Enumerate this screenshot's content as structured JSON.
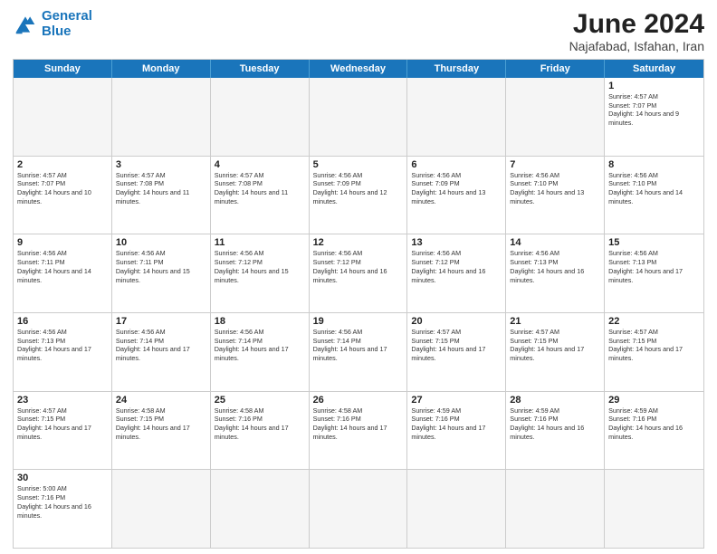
{
  "header": {
    "logo_general": "General",
    "logo_blue": "Blue",
    "title": "June 2024",
    "location": "Najafabad, Isfahan, Iran"
  },
  "weekdays": [
    "Sunday",
    "Monday",
    "Tuesday",
    "Wednesday",
    "Thursday",
    "Friday",
    "Saturday"
  ],
  "rows": [
    [
      {
        "day": "",
        "info": ""
      },
      {
        "day": "",
        "info": ""
      },
      {
        "day": "",
        "info": ""
      },
      {
        "day": "",
        "info": ""
      },
      {
        "day": "",
        "info": ""
      },
      {
        "day": "",
        "info": ""
      },
      {
        "day": "1",
        "info": "Sunrise: 4:57 AM\nSunset: 7:07 PM\nDaylight: 14 hours and 9 minutes."
      }
    ],
    [
      {
        "day": "2",
        "info": "Sunrise: 4:57 AM\nSunset: 7:07 PM\nDaylight: 14 hours and 10 minutes."
      },
      {
        "day": "3",
        "info": "Sunrise: 4:57 AM\nSunset: 7:08 PM\nDaylight: 14 hours and 11 minutes."
      },
      {
        "day": "4",
        "info": "Sunrise: 4:57 AM\nSunset: 7:08 PM\nDaylight: 14 hours and 11 minutes."
      },
      {
        "day": "5",
        "info": "Sunrise: 4:56 AM\nSunset: 7:09 PM\nDaylight: 14 hours and 12 minutes."
      },
      {
        "day": "6",
        "info": "Sunrise: 4:56 AM\nSunset: 7:09 PM\nDaylight: 14 hours and 13 minutes."
      },
      {
        "day": "7",
        "info": "Sunrise: 4:56 AM\nSunset: 7:10 PM\nDaylight: 14 hours and 13 minutes."
      },
      {
        "day": "8",
        "info": "Sunrise: 4:56 AM\nSunset: 7:10 PM\nDaylight: 14 hours and 14 minutes."
      }
    ],
    [
      {
        "day": "9",
        "info": "Sunrise: 4:56 AM\nSunset: 7:11 PM\nDaylight: 14 hours and 14 minutes."
      },
      {
        "day": "10",
        "info": "Sunrise: 4:56 AM\nSunset: 7:11 PM\nDaylight: 14 hours and 15 minutes."
      },
      {
        "day": "11",
        "info": "Sunrise: 4:56 AM\nSunset: 7:12 PM\nDaylight: 14 hours and 15 minutes."
      },
      {
        "day": "12",
        "info": "Sunrise: 4:56 AM\nSunset: 7:12 PM\nDaylight: 14 hours and 16 minutes."
      },
      {
        "day": "13",
        "info": "Sunrise: 4:56 AM\nSunset: 7:12 PM\nDaylight: 14 hours and 16 minutes."
      },
      {
        "day": "14",
        "info": "Sunrise: 4:56 AM\nSunset: 7:13 PM\nDaylight: 14 hours and 16 minutes."
      },
      {
        "day": "15",
        "info": "Sunrise: 4:56 AM\nSunset: 7:13 PM\nDaylight: 14 hours and 17 minutes."
      }
    ],
    [
      {
        "day": "16",
        "info": "Sunrise: 4:56 AM\nSunset: 7:13 PM\nDaylight: 14 hours and 17 minutes."
      },
      {
        "day": "17",
        "info": "Sunrise: 4:56 AM\nSunset: 7:14 PM\nDaylight: 14 hours and 17 minutes."
      },
      {
        "day": "18",
        "info": "Sunrise: 4:56 AM\nSunset: 7:14 PM\nDaylight: 14 hours and 17 minutes."
      },
      {
        "day": "19",
        "info": "Sunrise: 4:56 AM\nSunset: 7:14 PM\nDaylight: 14 hours and 17 minutes."
      },
      {
        "day": "20",
        "info": "Sunrise: 4:57 AM\nSunset: 7:15 PM\nDaylight: 14 hours and 17 minutes."
      },
      {
        "day": "21",
        "info": "Sunrise: 4:57 AM\nSunset: 7:15 PM\nDaylight: 14 hours and 17 minutes."
      },
      {
        "day": "22",
        "info": "Sunrise: 4:57 AM\nSunset: 7:15 PM\nDaylight: 14 hours and 17 minutes."
      }
    ],
    [
      {
        "day": "23",
        "info": "Sunrise: 4:57 AM\nSunset: 7:15 PM\nDaylight: 14 hours and 17 minutes."
      },
      {
        "day": "24",
        "info": "Sunrise: 4:58 AM\nSunset: 7:15 PM\nDaylight: 14 hours and 17 minutes."
      },
      {
        "day": "25",
        "info": "Sunrise: 4:58 AM\nSunset: 7:16 PM\nDaylight: 14 hours and 17 minutes."
      },
      {
        "day": "26",
        "info": "Sunrise: 4:58 AM\nSunset: 7:16 PM\nDaylight: 14 hours and 17 minutes."
      },
      {
        "day": "27",
        "info": "Sunrise: 4:59 AM\nSunset: 7:16 PM\nDaylight: 14 hours and 17 minutes."
      },
      {
        "day": "28",
        "info": "Sunrise: 4:59 AM\nSunset: 7:16 PM\nDaylight: 14 hours and 16 minutes."
      },
      {
        "day": "29",
        "info": "Sunrise: 4:59 AM\nSunset: 7:16 PM\nDaylight: 14 hours and 16 minutes."
      }
    ],
    [
      {
        "day": "30",
        "info": "Sunrise: 5:00 AM\nSunset: 7:16 PM\nDaylight: 14 hours and 16 minutes."
      },
      {
        "day": "",
        "info": ""
      },
      {
        "day": "",
        "info": ""
      },
      {
        "day": "",
        "info": ""
      },
      {
        "day": "",
        "info": ""
      },
      {
        "day": "",
        "info": ""
      },
      {
        "day": "",
        "info": ""
      }
    ]
  ]
}
